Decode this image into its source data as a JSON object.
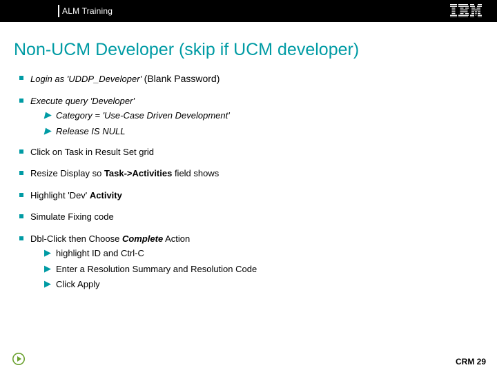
{
  "header": {
    "section": "ALM Training"
  },
  "title": "Non-UCM Developer (skip if UCM developer)",
  "bullets": {
    "b1_pre": "Login as 'UDDP_Developer' ",
    "b1_bold": "(Blank Password)",
    "b2": "Execute query 'Developer'",
    "b2_sub1": "Category = 'Use-Case Driven Development'",
    "b2_sub2": "Release IS NULL",
    "b3": "Click on Task in Result Set grid",
    "b4_pre": "Resize Display so ",
    "b4_bold": "Task->Activities",
    "b4_post": " field shows",
    "b5_pre": "Highlight 'Dev' ",
    "b5_bold": "Activity",
    "b6": "Simulate Fixing code",
    "b7_pre": "Dbl-Click then Choose ",
    "b7_italic": "Complete",
    "b7_post": " Action",
    "b7_sub1": "highlight ID and Ctrl-C",
    "b7_sub2": "Enter a Resolution Summary and Resolution Code",
    "b7_sub3": "Click Apply"
  },
  "footer": {
    "label": "CRM 29"
  },
  "colors": {
    "accent": "#009ba4"
  }
}
